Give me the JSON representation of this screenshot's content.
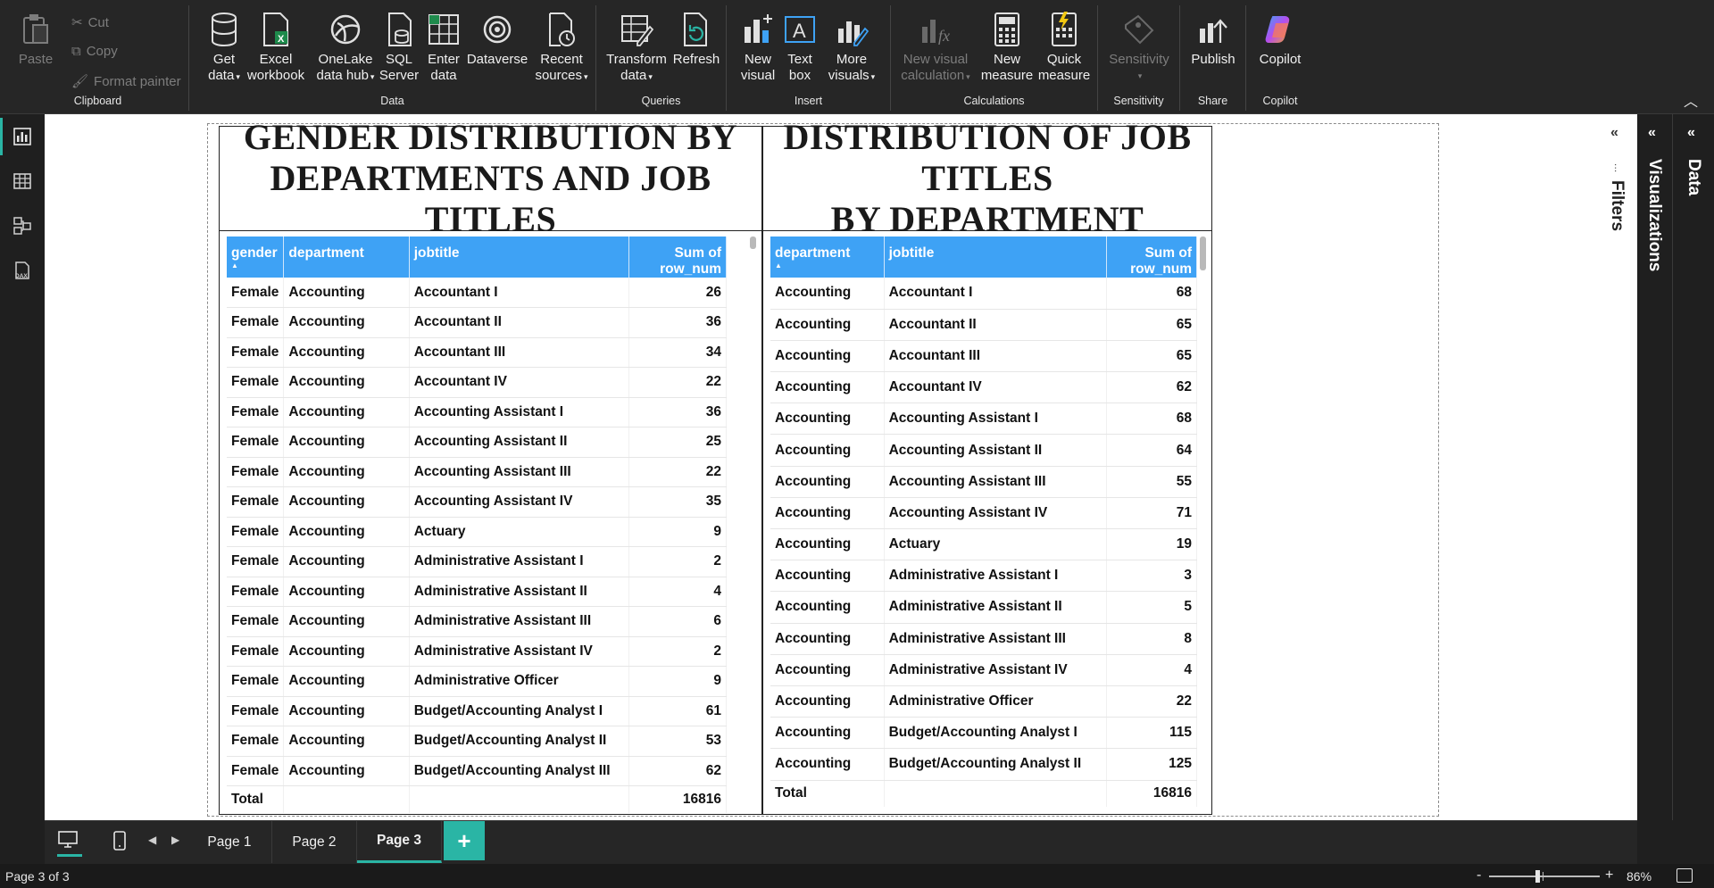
{
  "ribbon": {
    "clipboard": {
      "label": "Clipboard",
      "paste": "Paste",
      "cut": "Cut",
      "copy": "Copy",
      "format_painter": "Format painter"
    },
    "data": {
      "label": "Data",
      "get_data": [
        "Get",
        "data"
      ],
      "excel": [
        "Excel",
        "workbook"
      ],
      "onelake": [
        "OneLake",
        "data hub"
      ],
      "sql": [
        "SQL",
        "Server"
      ],
      "enter": [
        "Enter",
        "data"
      ],
      "dataverse": [
        "Dataverse",
        ""
      ],
      "recent": [
        "Recent",
        "sources"
      ]
    },
    "queries": {
      "label": "Queries",
      "transform": [
        "Transform",
        "data"
      ],
      "refresh": [
        "Refresh",
        ""
      ]
    },
    "insert": {
      "label": "Insert",
      "new_visual": [
        "New",
        "visual"
      ],
      "text_box": [
        "Text",
        "box"
      ],
      "more_visuals": [
        "More",
        "visuals"
      ]
    },
    "calculations": {
      "label": "Calculations",
      "new_visual_calc": [
        "New visual",
        "calculation"
      ],
      "new_measure": [
        "New",
        "measure"
      ],
      "quick_measure": [
        "Quick",
        "measure"
      ]
    },
    "sensitivity": {
      "label": "Sensitivity",
      "btn": "Sensitivity"
    },
    "share": {
      "label": "Share",
      "publish": "Publish"
    },
    "copilot": {
      "label": "Copilot",
      "btn": "Copilot"
    }
  },
  "left_table": {
    "title_line1": "GENDER DISTRIBUTION BY",
    "title_line2": "DEPARTMENTS AND JOB TITLES",
    "headers": [
      "gender",
      "department",
      "jobtitle",
      "Sum of row_num"
    ],
    "rows": [
      [
        "Female",
        "Accounting",
        "Accountant I",
        "26"
      ],
      [
        "Female",
        "Accounting",
        "Accountant II",
        "36"
      ],
      [
        "Female",
        "Accounting",
        "Accountant III",
        "34"
      ],
      [
        "Female",
        "Accounting",
        "Accountant IV",
        "22"
      ],
      [
        "Female",
        "Accounting",
        "Accounting Assistant I",
        "36"
      ],
      [
        "Female",
        "Accounting",
        "Accounting Assistant II",
        "25"
      ],
      [
        "Female",
        "Accounting",
        "Accounting Assistant III",
        "22"
      ],
      [
        "Female",
        "Accounting",
        "Accounting Assistant IV",
        "35"
      ],
      [
        "Female",
        "Accounting",
        "Actuary",
        "9"
      ],
      [
        "Female",
        "Accounting",
        "Administrative Assistant I",
        "2"
      ],
      [
        "Female",
        "Accounting",
        "Administrative Assistant II",
        "4"
      ],
      [
        "Female",
        "Accounting",
        "Administrative Assistant III",
        "6"
      ],
      [
        "Female",
        "Accounting",
        "Administrative Assistant IV",
        "2"
      ],
      [
        "Female",
        "Accounting",
        "Administrative Officer",
        "9"
      ],
      [
        "Female",
        "Accounting",
        "Budget/Accounting Analyst I",
        "61"
      ],
      [
        "Female",
        "Accounting",
        "Budget/Accounting Analyst II",
        "53"
      ],
      [
        "Female",
        "Accounting",
        "Budget/Accounting Analyst III",
        "62"
      ]
    ],
    "total_label": "Total",
    "total_value": "16816"
  },
  "right_table": {
    "title_line1": "DISTRIBUTION OF JOB TITLES",
    "title_line2": "BY DEPARTMENT",
    "headers": [
      "department",
      "jobtitle",
      "Sum of row_num"
    ],
    "rows": [
      [
        "Accounting",
        "Accountant I",
        "68"
      ],
      [
        "Accounting",
        "Accountant II",
        "65"
      ],
      [
        "Accounting",
        "Accountant III",
        "65"
      ],
      [
        "Accounting",
        "Accountant IV",
        "62"
      ],
      [
        "Accounting",
        "Accounting Assistant I",
        "68"
      ],
      [
        "Accounting",
        "Accounting Assistant II",
        "64"
      ],
      [
        "Accounting",
        "Accounting Assistant III",
        "55"
      ],
      [
        "Accounting",
        "Accounting Assistant IV",
        "71"
      ],
      [
        "Accounting",
        "Actuary",
        "19"
      ],
      [
        "Accounting",
        "Administrative Assistant I",
        "3"
      ],
      [
        "Accounting",
        "Administrative Assistant II",
        "5"
      ],
      [
        "Accounting",
        "Administrative Assistant III",
        "8"
      ],
      [
        "Accounting",
        "Administrative Assistant IV",
        "4"
      ],
      [
        "Accounting",
        "Administrative Officer",
        "22"
      ],
      [
        "Accounting",
        "Budget/Accounting Analyst I",
        "115"
      ],
      [
        "Accounting",
        "Budget/Accounting Analyst II",
        "125"
      ]
    ],
    "total_label": "Total",
    "total_value": "16816"
  },
  "side_panels": {
    "filters": "Filters",
    "visualizations": "Visualizations",
    "data": "Data"
  },
  "tabs": [
    {
      "label": "Page 1"
    },
    {
      "label": "Page 2"
    },
    {
      "label": "Page 3"
    }
  ],
  "add_page": "+",
  "status": {
    "page_indicator": "Page 3 of 3",
    "zoom": "86%",
    "zoom_minus": "-",
    "zoom_plus": "+"
  },
  "colors": {
    "header_blue": "#3ea2f5",
    "accent_teal": "#2ab5a5",
    "ribbon_bg": "#262626"
  },
  "icons": [
    "paste-icon",
    "cut-icon",
    "copy-icon",
    "format-painter-icon",
    "database-icon",
    "excel-icon",
    "onelake-icon",
    "sql-server-icon",
    "enter-data-icon",
    "dataverse-icon",
    "recent-sources-icon",
    "transform-icon",
    "refresh-icon",
    "new-visual-icon",
    "text-box-icon",
    "more-visuals-icon",
    "visual-calc-icon",
    "calculator-icon",
    "quick-measure-icon",
    "sensitivity-icon",
    "publish-icon",
    "copilot-icon"
  ]
}
